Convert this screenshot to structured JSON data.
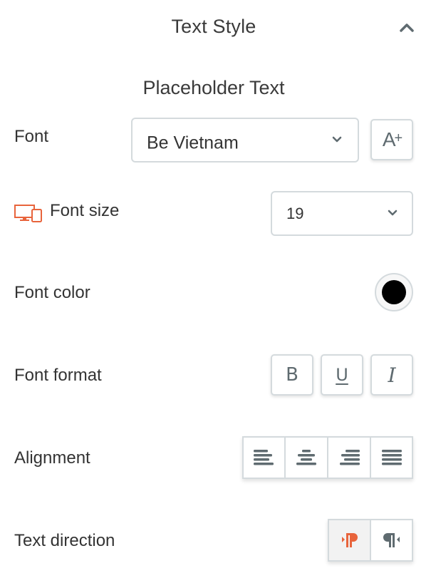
{
  "header": {
    "title": "Text Style",
    "collapse_icon": "chevron-up-icon"
  },
  "preview": {
    "text": "Placeholder Text"
  },
  "font": {
    "label": "Font",
    "selected": "Be Vietnam",
    "add_font_icon": "A+",
    "add_font_label": "A+"
  },
  "font_size": {
    "label": "Font size",
    "device_icon": "responsive-devices-icon",
    "selected": "19"
  },
  "font_color": {
    "label": "Font color",
    "value": "#000000"
  },
  "font_format": {
    "label": "Font format",
    "options": [
      {
        "name": "bold",
        "glyph": "B"
      },
      {
        "name": "underline",
        "glyph": "U"
      },
      {
        "name": "italic",
        "glyph": "I"
      }
    ]
  },
  "alignment": {
    "label": "Alignment",
    "options": [
      "left",
      "center",
      "right",
      "justify"
    ]
  },
  "text_direction": {
    "label": "Text direction",
    "options": [
      "ltr",
      "rtl"
    ],
    "selected": "ltr"
  },
  "colors": {
    "accent": "#e8643c",
    "icon": "#5f6b70",
    "border": "#d4dadd"
  }
}
